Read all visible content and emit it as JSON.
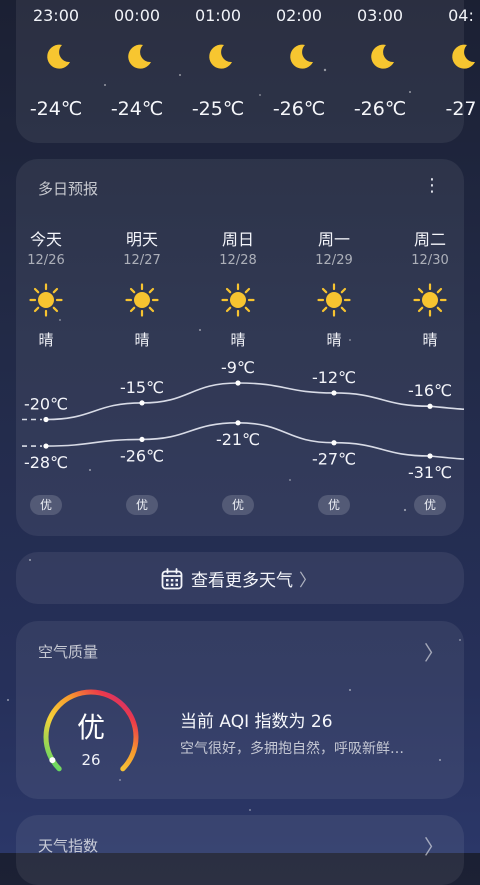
{
  "hourly": [
    {
      "time": "23:00",
      "icon": "moon-icon",
      "temp": "-24℃"
    },
    {
      "time": "00:00",
      "icon": "moon-icon",
      "temp": "-24℃"
    },
    {
      "time": "01:00",
      "icon": "moon-icon",
      "temp": "-25℃"
    },
    {
      "time": "02:00",
      "icon": "moon-icon",
      "temp": "-26℃"
    },
    {
      "time": "03:00",
      "icon": "moon-icon",
      "temp": "-26℃"
    },
    {
      "time": "04:",
      "icon": "moon-icon",
      "temp": "-27"
    }
  ],
  "daily": {
    "title": "多日预报",
    "menu": "⋮",
    "days": [
      {
        "name": "今天",
        "date": "12/26",
        "icon": "sun-icon",
        "cond": "晴",
        "high": -20,
        "low": -28,
        "high_label": "-20℃",
        "low_label": "-28℃",
        "aq": "优"
      },
      {
        "name": "明天",
        "date": "12/27",
        "icon": "sun-icon",
        "cond": "晴",
        "high": -15,
        "low": -26,
        "high_label": "-15℃",
        "low_label": "-26℃",
        "aq": "优"
      },
      {
        "name": "周日",
        "date": "12/28",
        "icon": "sun-icon",
        "cond": "晴",
        "high": -9,
        "low": -21,
        "high_label": "-9℃",
        "low_label": "-21℃",
        "aq": "优"
      },
      {
        "name": "周一",
        "date": "12/29",
        "icon": "sun-icon",
        "cond": "晴",
        "high": -12,
        "low": -27,
        "high_label": "-12℃",
        "low_label": "-27℃",
        "aq": "优"
      },
      {
        "name": "周二",
        "date": "12/30",
        "icon": "sun-icon",
        "cond": "晴",
        "high": -16,
        "low": -31,
        "high_label": "-16℃",
        "low_label": "-31℃",
        "aq": "优"
      }
    ]
  },
  "more_button": {
    "label": "查看更多天气",
    "icon": "calendar-icon",
    "chevron": "〉"
  },
  "aqi": {
    "title": "空气质量",
    "chevron": "〉",
    "level": "优",
    "value": "26",
    "value_number": 26,
    "headline": "当前 AQI 指数为 26",
    "desc": "空气很好，多拥抱自然，呼吸新鲜…"
  },
  "index_card": {
    "title": "天气指数",
    "chevron": "〉"
  },
  "colors": {
    "moon": "#f7c630",
    "sun": "#f7c430",
    "curve": "#d8dbe6"
  }
}
